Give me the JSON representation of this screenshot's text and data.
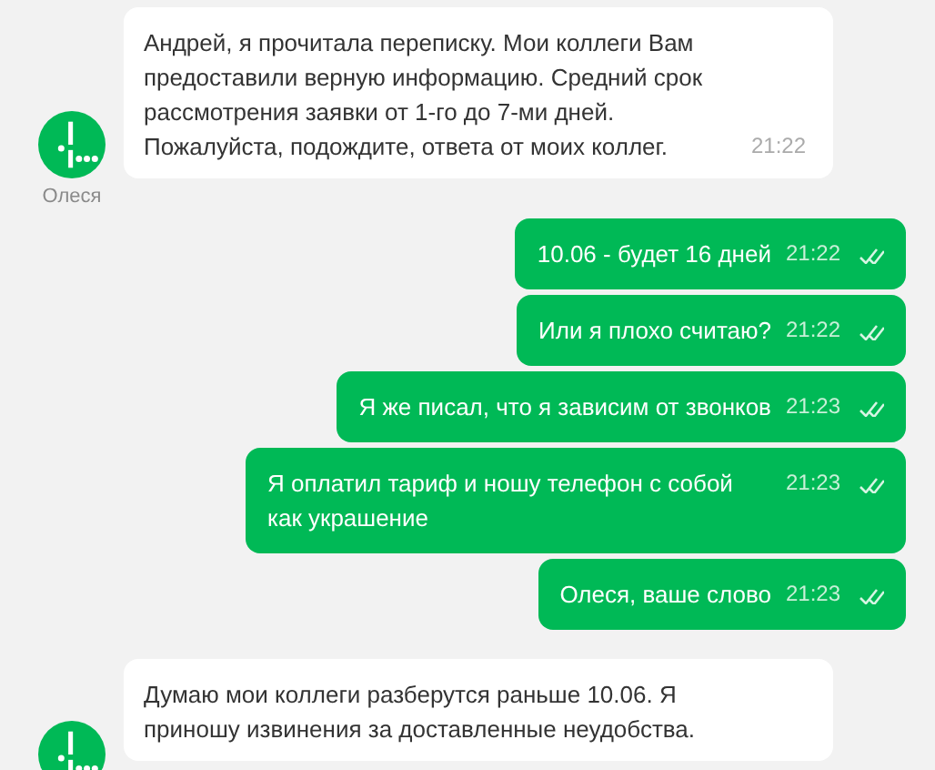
{
  "messages": [
    {
      "kind": "incoming",
      "text": "Андрей, я прочитала переписку. Мои коллеги Вам предоставили верную информацию. Средний срок рассмотрения заявки от 1-го до 7-ми дней. Пожалуйста, подождите, ответа от моих коллег.",
      "time": "21:22",
      "sender": "Олеся"
    },
    {
      "kind": "outgoing",
      "text": "10.06 - будет 16 дней",
      "time": "21:22",
      "read": true
    },
    {
      "kind": "outgoing",
      "text": "Или я плохо считаю?",
      "time": "21:22",
      "read": true
    },
    {
      "kind": "outgoing",
      "text": "Я же писал, что я зависим от звонков",
      "time": "21:23",
      "read": true
    },
    {
      "kind": "outgoing",
      "text": "Я оплатил тариф и ношу телефон с собой как украшение",
      "time": "21:23",
      "read": true
    },
    {
      "kind": "outgoing",
      "text": "Олеся, ваше слово",
      "time": "21:23",
      "read": true
    },
    {
      "kind": "incoming",
      "text": "Думаю мои коллеги разберутся раньше 10.06. Я приношу извинения за доставленные неудобства."
    }
  ]
}
